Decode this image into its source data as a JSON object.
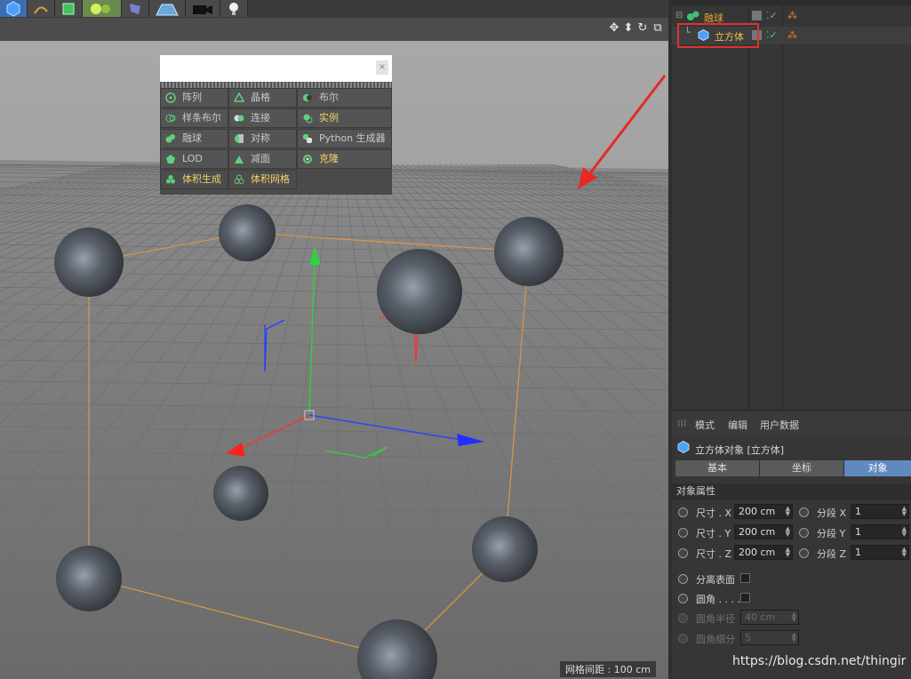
{
  "toolbar": {
    "icons": [
      "cube-icon",
      "spline-pen-icon",
      "green-cube-icon",
      "generator-icon",
      "deformer-icon",
      "floor-icon",
      "camera-icon",
      "light-icon"
    ]
  },
  "viewport": {
    "grid_spacing_label": "网格间距 : 100 cm",
    "header_icons": [
      "move-view-icon",
      "zoom-view-icon",
      "rotate-view-icon",
      "maximize-view-icon"
    ]
  },
  "popup_menu": {
    "items": [
      {
        "label": "阵列",
        "icon": "array-icon",
        "highlight": false
      },
      {
        "label": "晶格",
        "icon": "atom-icon",
        "highlight": false
      },
      {
        "label": "布尔",
        "icon": "boole-icon",
        "highlight": false
      },
      {
        "label": "样条布尔",
        "icon": "spline-boole-icon",
        "highlight": false
      },
      {
        "label": "连接",
        "icon": "connect-icon",
        "highlight": false
      },
      {
        "label": "实例",
        "icon": "instance-icon",
        "highlight": true
      },
      {
        "label": "融球",
        "icon": "metaball-icon",
        "highlight": false
      },
      {
        "label": "对称",
        "icon": "symmetry-icon",
        "highlight": false
      },
      {
        "label": "Python 生成器",
        "icon": "python-icon",
        "highlight": false
      },
      {
        "label": "LOD",
        "icon": "lod-icon",
        "highlight": false
      },
      {
        "label": "减面",
        "icon": "polygon-reduction-icon",
        "highlight": false
      },
      {
        "label": "克隆",
        "icon": "cloner-icon",
        "highlight": true
      },
      {
        "label": "体积生成",
        "icon": "volume-builder-icon",
        "highlight": true
      },
      {
        "label": "体积网格",
        "icon": "volume-mesher-icon",
        "highlight": true
      }
    ]
  },
  "object_manager": {
    "objects": [
      {
        "name": "融球",
        "icon": "metaball-icon",
        "color": "#e8a030"
      },
      {
        "name": "立方体",
        "icon": "cube-icon",
        "color": "#e8c050"
      }
    ]
  },
  "attributes": {
    "menu": [
      "模式",
      "编辑",
      "用户数据"
    ],
    "title": "立方体对象 [立方体]",
    "tabs": [
      "基本",
      "坐标",
      "对象"
    ],
    "active_tab": "对象",
    "section": "对象属性",
    "size_x_label": "尺寸 . X",
    "size_x_value": "200 cm",
    "size_y_label": "尺寸 . Y",
    "size_y_value": "200 cm",
    "size_z_label": "尺寸 . Z",
    "size_z_value": "200 cm",
    "seg_x_label": "分段 X",
    "seg_x_value": "1",
    "seg_y_label": "分段 Y",
    "seg_y_value": "1",
    "seg_z_label": "分段 Z",
    "seg_z_value": "1",
    "separate_surfaces_label": "分离表面",
    "fillet_label": "圆角 . . . .",
    "fillet_radius_label": "圆角半径",
    "fillet_radius_value": "40 cm",
    "fillet_subdiv_label": "圆角细分",
    "fillet_subdiv_value": "5"
  },
  "watermark": "https://blog.csdn.net/thingir",
  "colors": {
    "accent_tab": "#5f8ac0",
    "highlight_text": "#f0d36a",
    "annotation_red": "#e03030"
  }
}
